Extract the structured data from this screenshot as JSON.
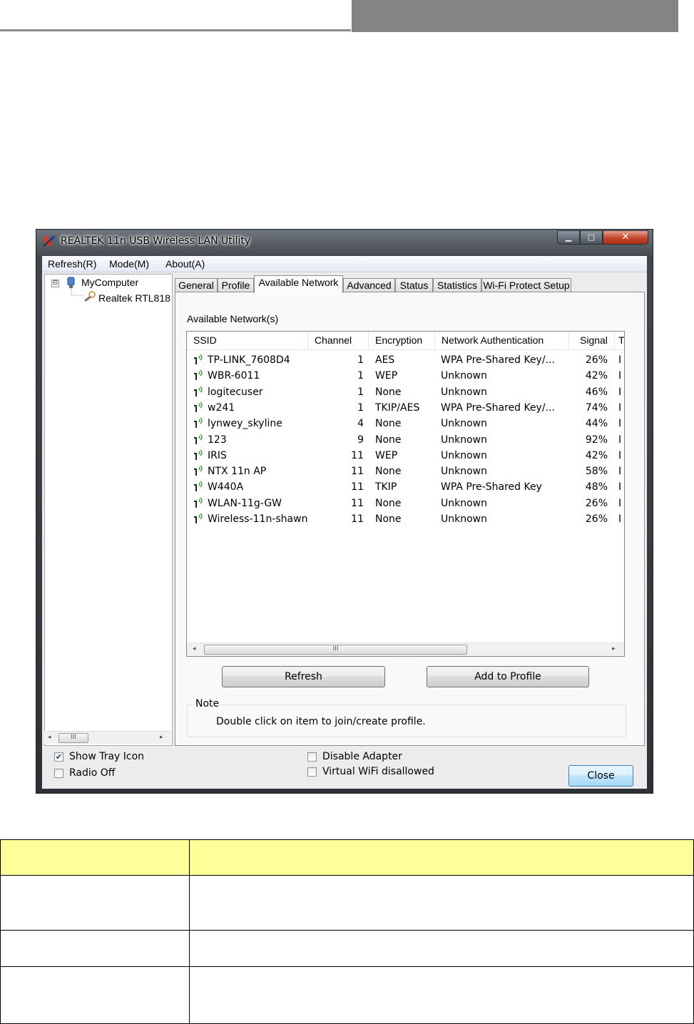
{
  "window": {
    "title": "REALTEK 11n USB Wireless LAN Utility",
    "min_glyph": "▁",
    "max_glyph": "▢",
    "close_glyph": "✕"
  },
  "menu": [
    "Refresh(R)",
    "Mode(M)",
    "About(A)"
  ],
  "tree": {
    "root": "MyComputer",
    "child": "Realtek RTL818",
    "expander": "⊟",
    "thumb_grip": "III"
  },
  "tabs": [
    "General",
    "Profile",
    "Available Network",
    "Advanced",
    "Status",
    "Statistics",
    "Wi-Fi Protect Setup"
  ],
  "active_tab": "Available Network",
  "available": {
    "section_title": "Available Network(s)",
    "columns": [
      "SSID",
      "Channel",
      "Encryption",
      "Network Authentication",
      "Signal",
      "T"
    ],
    "rows": [
      {
        "ssid": "TP-LINK_7608D4",
        "channel": "1",
        "encryption": "AES",
        "auth": "WPA Pre-Shared Key/...",
        "signal": "26%",
        "type": "I"
      },
      {
        "ssid": "WBR-6011",
        "channel": "1",
        "encryption": "WEP",
        "auth": "Unknown",
        "signal": "42%",
        "type": "I"
      },
      {
        "ssid": "logitecuser",
        "channel": "1",
        "encryption": "None",
        "auth": "Unknown",
        "signal": "46%",
        "type": "I"
      },
      {
        "ssid": "w241",
        "channel": "1",
        "encryption": "TKIP/AES",
        "auth": "WPA Pre-Shared Key/...",
        "signal": "74%",
        "type": "I"
      },
      {
        "ssid": "lynwey_skyline",
        "channel": "4",
        "encryption": "None",
        "auth": "Unknown",
        "signal": "44%",
        "type": "I"
      },
      {
        "ssid": "123",
        "channel": "9",
        "encryption": "None",
        "auth": "Unknown",
        "signal": "92%",
        "type": "I"
      },
      {
        "ssid": "IRIS",
        "channel": "11",
        "encryption": "WEP",
        "auth": "Unknown",
        "signal": "42%",
        "type": "I"
      },
      {
        "ssid": "NTX 11n AP",
        "channel": "11",
        "encryption": "None",
        "auth": "Unknown",
        "signal": "58%",
        "type": "I"
      },
      {
        "ssid": "W440A",
        "channel": "11",
        "encryption": "TKIP",
        "auth": "WPA Pre-Shared Key",
        "signal": "48%",
        "type": "I"
      },
      {
        "ssid": "WLAN-11g-GW",
        "channel": "11",
        "encryption": "None",
        "auth": "Unknown",
        "signal": "26%",
        "type": "I"
      },
      {
        "ssid": "Wireless-11n-shawn",
        "channel": "11",
        "encryption": "None",
        "auth": "Unknown",
        "signal": "26%",
        "type": "I"
      }
    ],
    "scroll_left": "◂",
    "scroll_right": "▸",
    "thumb_grip": "III",
    "refresh_label": "Refresh",
    "add_profile_label": "Add to Profile",
    "note_legend": "Note",
    "note_text": "Double click on item to join/create profile."
  },
  "footer": {
    "show_tray_icon": {
      "label": "Show Tray Icon",
      "checked": true
    },
    "radio_off": {
      "label": "Radio Off",
      "checked": false
    },
    "disable_adapter": {
      "label": "Disable Adapter",
      "checked": false
    },
    "virtual_wifi": {
      "label": "Virtual WiFi disallowed",
      "checked": false
    },
    "close_label": "Close",
    "check_glyph": "✔"
  },
  "colors": {
    "table_header": "#ffff99",
    "doc_bar": "#848484"
  }
}
